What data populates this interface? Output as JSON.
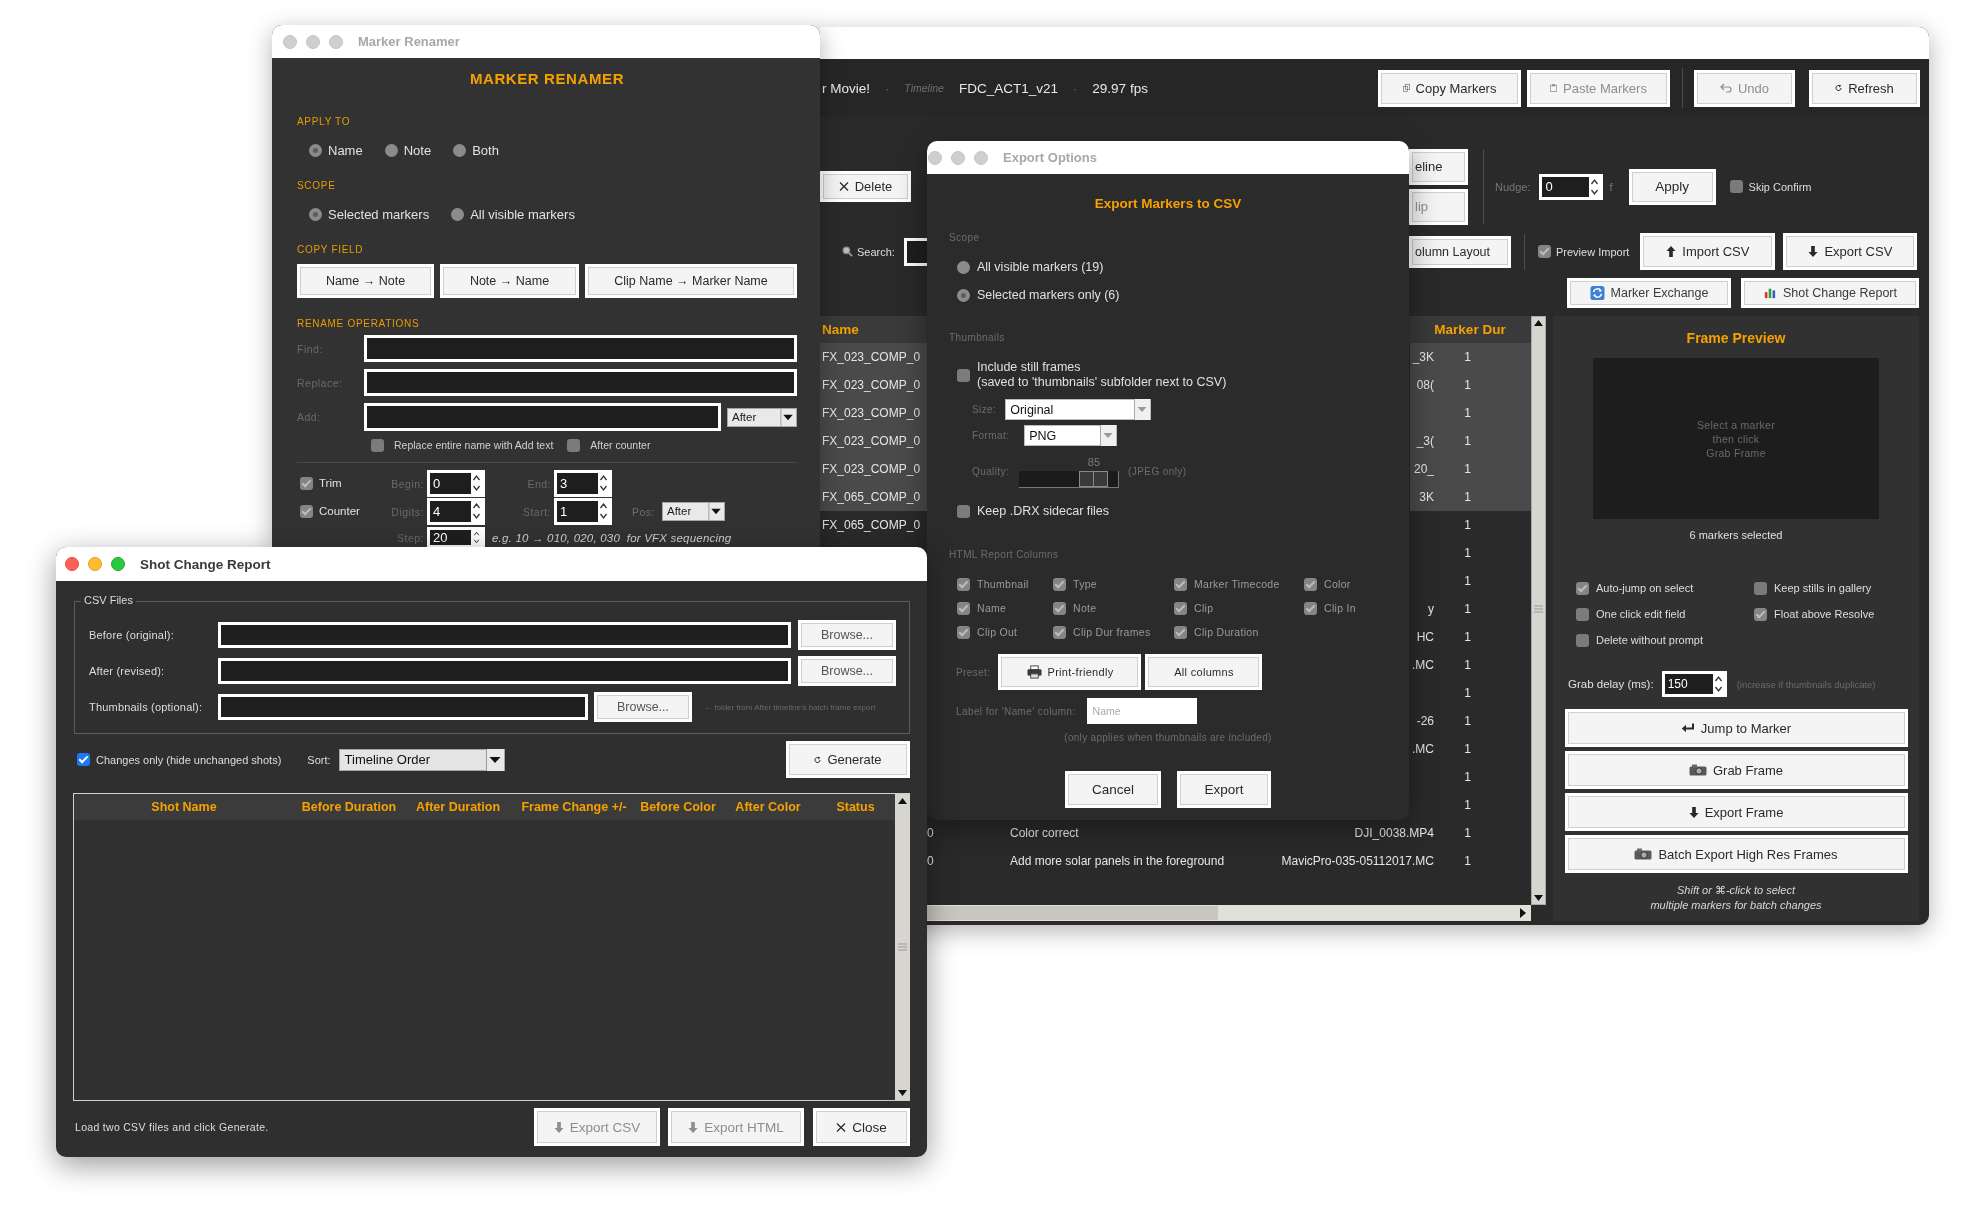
{
  "main_window": {
    "header": [
      {
        "kind": "value",
        "text": "r Movie!"
      },
      {
        "kind": "separator",
        "text": "·"
      },
      {
        "kind": "label",
        "text": "Timeline"
      },
      {
        "kind": "value",
        "text": "FDC_ACT1_v21"
      },
      {
        "kind": "separator",
        "text": "·"
      },
      {
        "kind": "value",
        "text": "29.97 fps"
      }
    ],
    "header_buttons": [
      {
        "label": "Copy Markers",
        "disabled": false
      },
      {
        "label": "Paste Markers",
        "disabled": true
      },
      {
        "label": "Undo",
        "disabled": true
      },
      {
        "label": "Refresh",
        "disabled": false
      }
    ],
    "delete_button": "Delete",
    "timeline_buttons": [
      {
        "label": "eline",
        "disabled": false
      },
      {
        "label": "lip",
        "disabled": true
      }
    ],
    "nudge": {
      "label": "Nudge:",
      "value": "0",
      "unit": "f"
    },
    "apply_button": "Apply",
    "skip_confirm": {
      "label": "Skip Confirm",
      "checked": false
    },
    "search": {
      "label": "Search:"
    },
    "column_layout_button": "olumn Layout",
    "preview_import": {
      "label": "Preview Import",
      "checked": true
    },
    "csv_buttons": [
      "Import CSV",
      "Export CSV"
    ],
    "tool_buttons": [
      "Marker Exchange",
      "Shot Change Report"
    ],
    "table": {
      "columns": {
        "name": "Name",
        "marker_dur": "Marker Dur"
      },
      "rows": [
        {
          "selected": true,
          "name": "FX_023_COMP_0",
          "column_4": "_3K",
          "marker_dur": "1"
        },
        {
          "selected": true,
          "name": "FX_023_COMP_0",
          "column_4": "08(",
          "marker_dur": "1"
        },
        {
          "selected": true,
          "name": "FX_023_COMP_0",
          "marker_dur": "1"
        },
        {
          "selected": true,
          "name": "FX_023_COMP_0",
          "column_4": "_3(",
          "marker_dur": "1"
        },
        {
          "selected": true,
          "name": "FX_023_COMP_0",
          "column_4": "20_",
          "marker_dur": "1"
        },
        {
          "selected": true,
          "name": "FX_065_COMP_0",
          "column_4": "3K",
          "marker_dur": "1"
        },
        {
          "selected": false,
          "name": "FX_065_COMP_0",
          "marker_dur": "1"
        },
        {
          "selected": false,
          "marker_dur": "1"
        },
        {
          "selected": false,
          "marker_dur": "1"
        },
        {
          "selected": false,
          "column_4": "y",
          "marker_dur": "1"
        },
        {
          "selected": false,
          "column_4": "HC",
          "marker_dur": "1"
        },
        {
          "selected": false,
          "column_4": ".MC",
          "marker_dur": "1"
        },
        {
          "selected": false,
          "marker_dur": "1"
        },
        {
          "selected": false,
          "column_4": "-26",
          "marker_dur": "1"
        },
        {
          "selected": false,
          "column_4": ".MC",
          "marker_dur": "1"
        },
        {
          "selected": false,
          "marker_dur": "1"
        },
        {
          "selected": false,
          "marker_dur": "1"
        },
        {
          "selected": false,
          "column_2": "0",
          "column_3": "Color correct",
          "column_4": "DJI_0038.MP4",
          "marker_dur": "1"
        },
        {
          "selected": false,
          "column_2": "0",
          "column_3": "Add more solar panels in the foreground",
          "column_4": "MavicPro-035-05112017.MC",
          "marker_dur": "1"
        }
      ]
    },
    "frame_preview": {
      "title": "Frame Preview",
      "message": "Select a marker\nthen click\nGrab Frame",
      "status": "6 markers selected",
      "options": [
        {
          "label": "Auto-jump on select",
          "checked": true
        },
        {
          "label": "Keep stills in gallery",
          "checked": false
        },
        {
          "label": "One click edit field",
          "checked": false
        },
        {
          "label": "Float above Resolve",
          "checked": true
        },
        {
          "label": "Delete without prompt",
          "checked": false
        }
      ],
      "grab_delay": {
        "label": "Grab delay (ms):",
        "value": "150",
        "hint": "(increase if thumbnails duplicate)"
      },
      "buttons": [
        "Jump to Marker",
        "Grab Frame",
        "Export Frame",
        "Batch Export High Res Frames"
      ],
      "footer": "Shift or ⌘-click to select\nmultiple markers for batch changes"
    }
  },
  "marker_renamer": {
    "title": "Marker Renamer",
    "heading": "MARKER RENAMER",
    "apply_to": {
      "label": "APPLY TO",
      "options": [
        {
          "label": "Name",
          "selected": true
        },
        {
          "label": "Note",
          "selected": false
        },
        {
          "label": "Both",
          "selected": false
        }
      ]
    },
    "scope": {
      "label": "SCOPE",
      "options": [
        {
          "label": "Selected markers",
          "selected": true
        },
        {
          "label": "All visible markers",
          "selected": false
        }
      ]
    },
    "copy_field": {
      "label": "COPY FIELD",
      "buttons": [
        "Name → Note",
        "Note → Name",
        "Clip Name → Marker Name"
      ]
    },
    "rename_operations": {
      "label": "RENAME OPERATIONS",
      "find_label": "Find:",
      "replace_label": "Replace:",
      "add_label": "Add:",
      "add_position": "After",
      "replace_entire": {
        "label": "Replace entire name with Add text",
        "checked": false
      },
      "after_counter": {
        "label": "After counter",
        "checked": false
      }
    },
    "trim": {
      "label": "Trim",
      "checked": true,
      "begin_label": "Begin:",
      "begin": "0",
      "end_label": "End:",
      "end": "3"
    },
    "counter": {
      "label": "Counter",
      "checked": true,
      "digits_label": "Digits:",
      "digits": "4",
      "start_label": "Start:",
      "start": "1",
      "pos_label": "Pos:",
      "pos": "After",
      "step_label": "Step:",
      "step": "20",
      "hint": "e.g. 10 → 010, 020, 030  for VFX sequencing"
    }
  },
  "export_options": {
    "title": "Export Options",
    "heading": "Export Markers to CSV",
    "scope": {
      "label": "Scope",
      "options": [
        {
          "label": "All visible markers  (19)",
          "selected": false
        },
        {
          "label": "Selected markers only  (6)",
          "selected": true
        }
      ]
    },
    "thumbnails": {
      "label": "Thumbnails",
      "include": {
        "label": "Include still frames\n(saved to 'thumbnails' subfolder next to CSV)",
        "checked": false
      },
      "size_label": "Size:",
      "size": "Original",
      "format_label": "Format:",
      "format": "PNG",
      "quality": {
        "label": "Quality:",
        "reading": "85",
        "level": 0.85,
        "note": "(JPEG only)"
      },
      "keep_drx": {
        "label": "Keep .DRX sidecar files",
        "checked": false
      }
    },
    "report_columns": {
      "label": "HTML Report Columns",
      "items": [
        {
          "label": "Thumbnail",
          "checked": true
        },
        {
          "label": "Type",
          "checked": true
        },
        {
          "label": "Marker Timecode",
          "checked": true
        },
        {
          "label": "Color",
          "checked": true
        },
        {
          "label": "Name",
          "checked": true
        },
        {
          "label": "Note",
          "checked": true
        },
        {
          "label": "Clip",
          "checked": true
        },
        {
          "label": "Clip In",
          "checked": true
        },
        {
          "label": "Clip Out",
          "checked": true
        },
        {
          "label": "Clip Dur frames",
          "checked": true
        },
        {
          "label": "Clip Duration",
          "checked": true
        }
      ]
    },
    "preset": {
      "label": "Preset:",
      "buttons": [
        "Print-friendly",
        "All columns"
      ]
    },
    "name_label": {
      "label": "Label for 'Name' column:",
      "placeholder": "Name"
    },
    "note": "(only applies when thumbnails are included)",
    "buttons": [
      "Cancel",
      "Export"
    ]
  },
  "shot_change_report": {
    "title": "Shot Change Report",
    "csv_files": {
      "legend": "CSV Files",
      "rows": [
        {
          "label": "Before (original):",
          "button": "Browse..."
        },
        {
          "label": "After (revised):",
          "button": "Browse..."
        },
        {
          "label": "Thumbnails (optional):",
          "button": "Browse...",
          "hint": "← folder from After timeline's batch frame export"
        }
      ]
    },
    "changes_only": {
      "label": "Changes only (hide unchanged shots)",
      "checked": true
    },
    "sort": {
      "label": "Sort:",
      "value": "Timeline Order"
    },
    "generate_button": "Generate",
    "table": {
      "columns": [
        "Shot Name",
        "Before Duration",
        "After Duration",
        "Frame Change +/-",
        "Before Color",
        "After Color",
        "Status"
      ]
    },
    "status": "Load two CSV files and click Generate.",
    "buttons": [
      {
        "label": "Export CSV",
        "disabled": true
      },
      {
        "label": "Export HTML",
        "disabled": true
      },
      {
        "label": "Close",
        "disabled": false
      }
    ]
  }
}
